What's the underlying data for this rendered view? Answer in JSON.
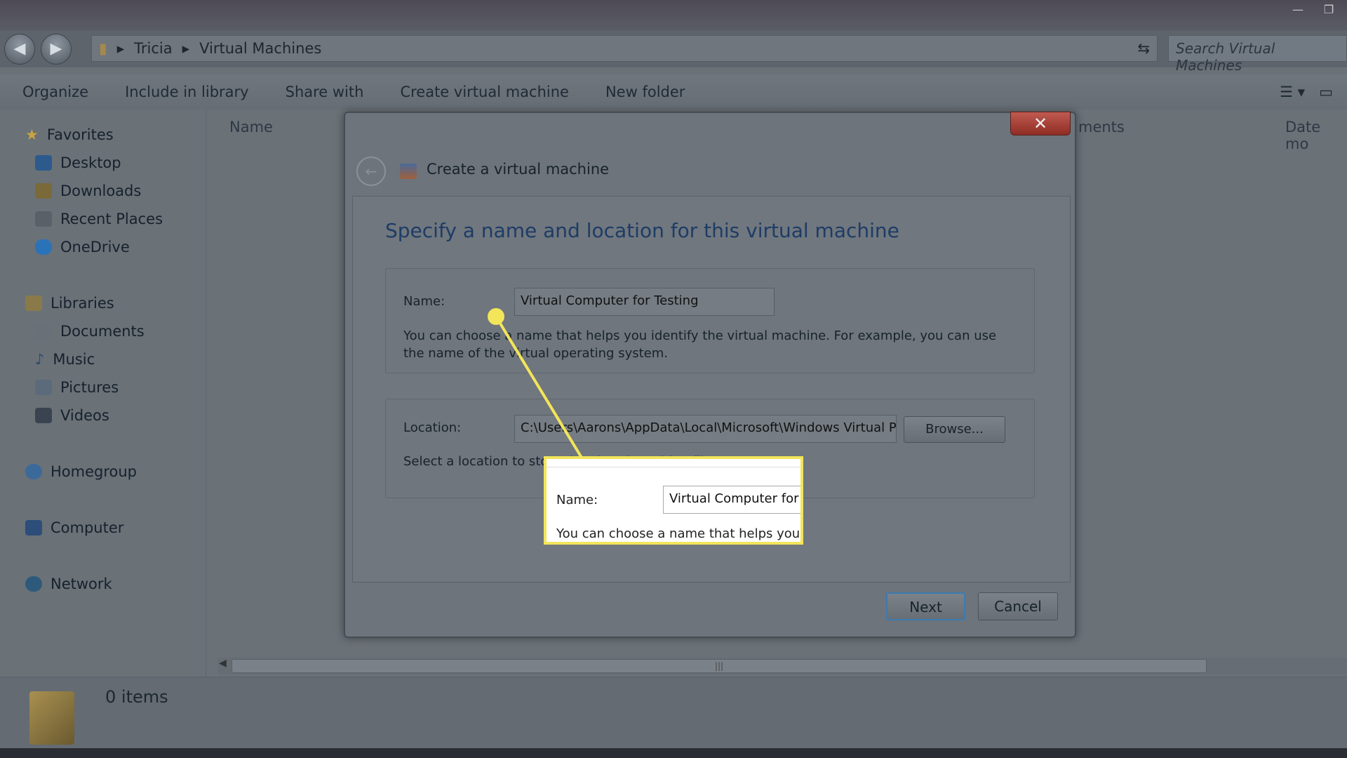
{
  "explorer": {
    "breadcrumb": [
      "Tricia",
      "Virtual Machines"
    ],
    "search_placeholder": "Search Virtual Machines",
    "toolbar": {
      "organize": "Organize",
      "include": "Include in library",
      "share": "Share with",
      "create": "Create virtual machine",
      "new_folder": "New folder"
    },
    "sidebar": {
      "favorites": "Favorites",
      "desktop": "Desktop",
      "downloads": "Downloads",
      "recent": "Recent Places",
      "onedrive": "OneDrive",
      "libraries": "Libraries",
      "documents": "Documents",
      "music": "Music",
      "pictures": "Pictures",
      "videos": "Videos",
      "homegroup": "Homegroup",
      "computer": "Computer",
      "network": "Network"
    },
    "columns": {
      "name": "Name",
      "attachments": "ments",
      "date": "Date mo"
    },
    "status": "0 items"
  },
  "dialog": {
    "title": "Create a virtual machine",
    "heading": "Specify a name and location for this virtual machine",
    "name_label": "Name:",
    "name_value": "Virtual Computer for Testing",
    "name_help": "You can choose a name that helps you identify the virtual machine. For example, you can use the name of the virtual operating system.",
    "location_label": "Location:",
    "location_value": "C:\\Users\\Aarons\\AppData\\Local\\Microsoft\\Windows Virtual PC",
    "browse": "Browse...",
    "location_help": "Select a location to store the virtual machine file.",
    "next": "Next",
    "cancel": "Cancel"
  },
  "callout": {
    "name_label": "Name:",
    "name_value": "Virtual Computer for Te",
    "help": "You can choose a name that helps you ide",
    "color": "#f2e55a"
  }
}
